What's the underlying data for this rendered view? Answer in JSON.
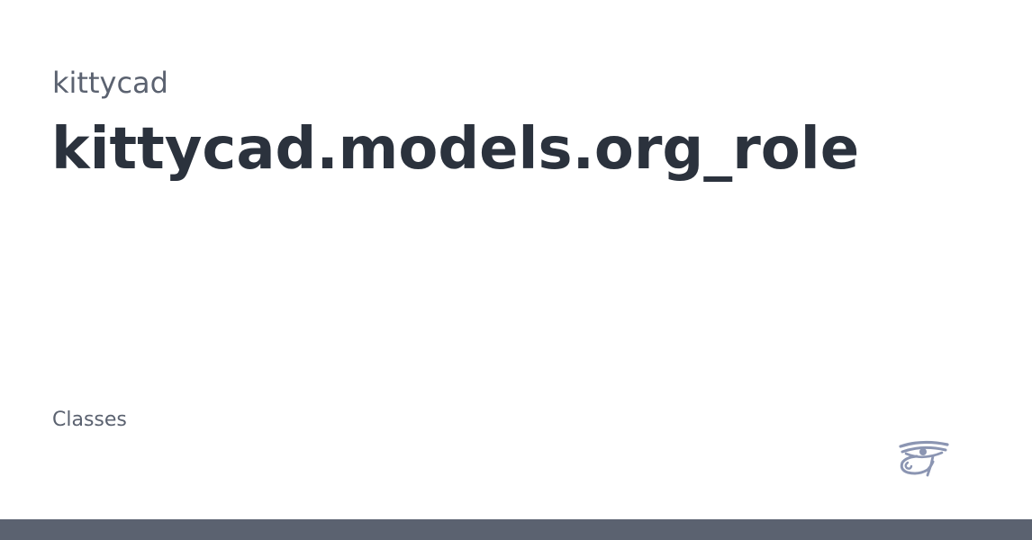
{
  "header": {
    "package_name": "kittycad",
    "module_title": "kittycad.models.org_role"
  },
  "content": {
    "section_label": "Classes"
  },
  "branding": {
    "logo_icon": "eye-of-horus-icon",
    "logo_color": "#8b95b2"
  },
  "footer": {
    "bar_color": "#5b6270"
  }
}
